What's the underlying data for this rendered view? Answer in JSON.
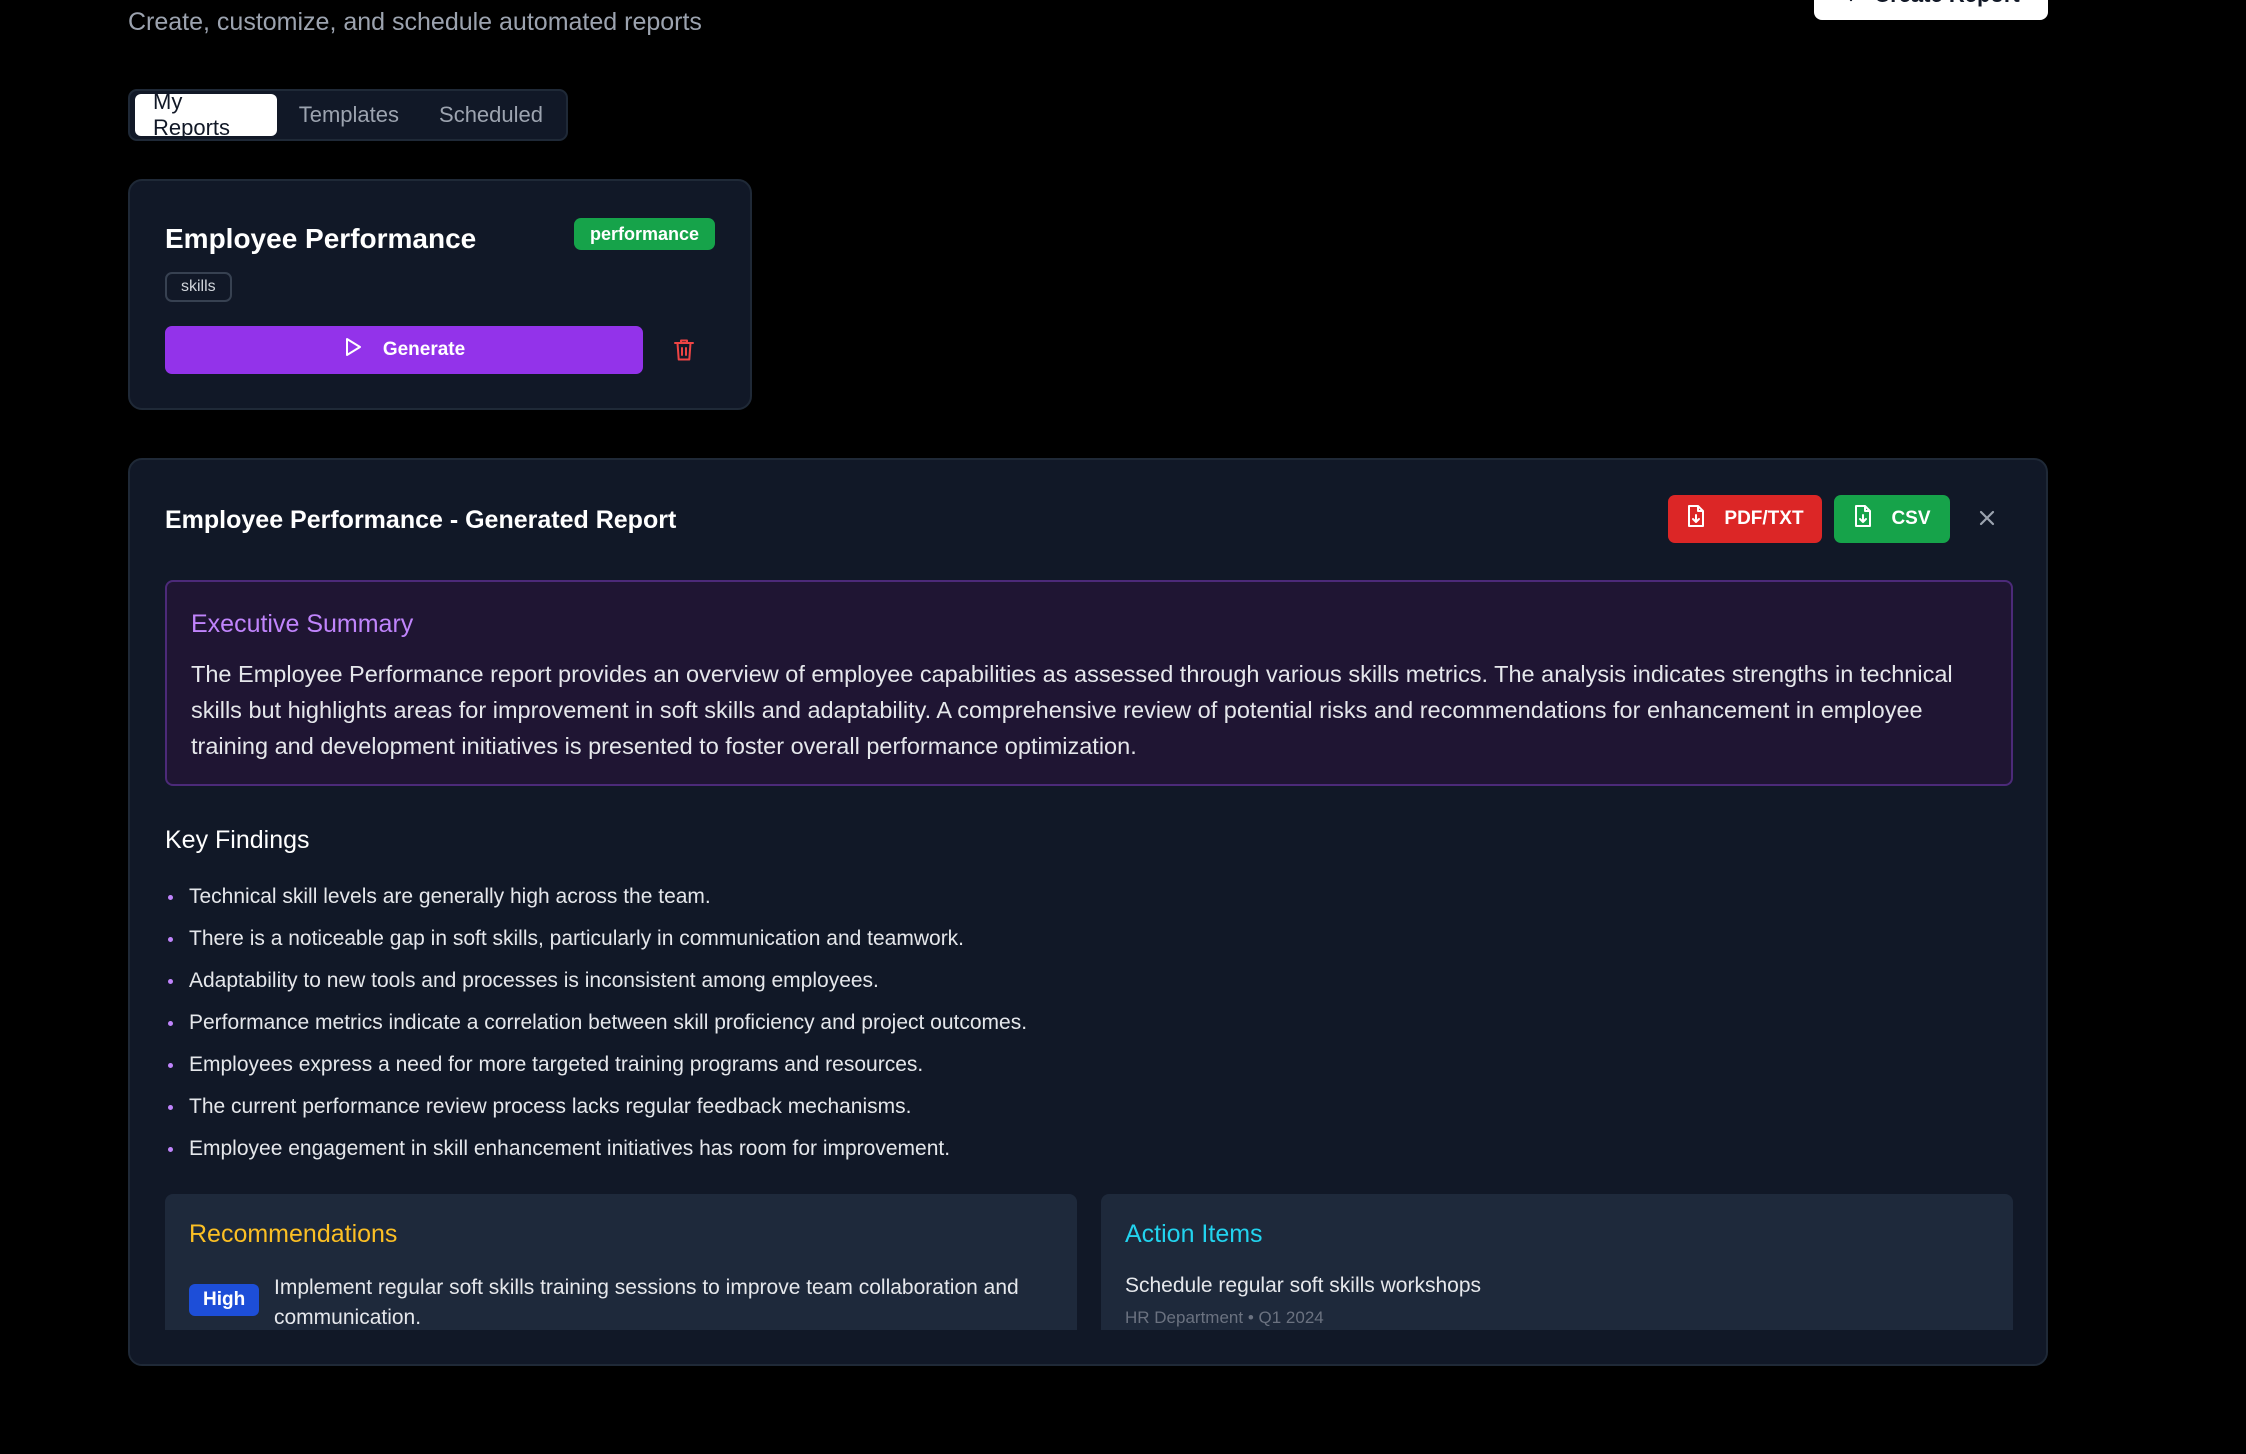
{
  "header": {
    "subtitle": "Create, customize, and schedule automated reports",
    "create_button": "Create Report"
  },
  "tabs": [
    {
      "label": "My Reports",
      "active": true
    },
    {
      "label": "Templates",
      "active": false
    },
    {
      "label": "Scheduled",
      "active": false
    }
  ],
  "report_card": {
    "title": "Employee Performance",
    "category_badge": "performance",
    "tag": "skills",
    "generate_label": "Generate"
  },
  "generated": {
    "title": "Employee Performance - Generated Report",
    "pdf_label": "PDF/TXT",
    "csv_label": "CSV",
    "executive_summary": {
      "heading": "Executive Summary",
      "text": "The Employee Performance report provides an overview of employee capabilities as assessed through various skills metrics. The analysis indicates strengths in technical skills but highlights areas for improvement in soft skills and adaptability. A comprehensive review of potential risks and recommendations for enhancement in employee training and development initiatives is presented to foster overall performance optimization."
    },
    "key_findings": {
      "heading": "Key Findings",
      "items": [
        "Technical skill levels are generally high across the team.",
        "There is a noticeable gap in soft skills, particularly in communication and teamwork.",
        "Adaptability to new tools and processes is inconsistent among employees.",
        "Performance metrics indicate a correlation between skill proficiency and project outcomes.",
        "Employees express a need for more targeted training programs and resources.",
        "The current performance review process lacks regular feedback mechanisms.",
        "Employee engagement in skill enhancement initiatives has room for improvement."
      ]
    },
    "recommendations": {
      "heading": "Recommendations",
      "items": [
        {
          "priority": "High",
          "text": "Implement regular soft skills training sessions to improve team collaboration and communication."
        }
      ]
    },
    "action_items": {
      "heading": "Action Items",
      "items": [
        {
          "text": "Schedule regular soft skills workshops",
          "owner": "HR Department",
          "due": "Q1 2024"
        }
      ]
    }
  },
  "colors": {
    "accent_purple": "#9333ea",
    "pdf_red": "#dc2626",
    "csv_green": "#16a34a",
    "priority_blue": "#1d4ed8"
  }
}
